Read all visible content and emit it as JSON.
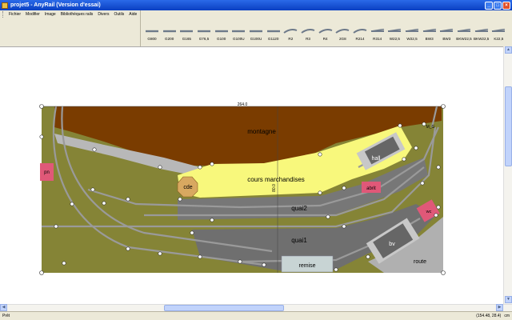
{
  "window": {
    "title": "projet5 - AnyRail (Version d'essai)"
  },
  "menu": [
    "Fichier",
    "Modifier",
    "Image",
    "Bibliothèques rails",
    "Divers",
    "Outils",
    "Aide"
  ],
  "tools": [
    "G800",
    "G200",
    "G165",
    "G76,5",
    "G100",
    "G100U",
    "G100U",
    "G1120",
    "R2",
    "R3",
    "R4",
    "2G8",
    "R214",
    "R314",
    "W22,5",
    "W22,5",
    "BW3",
    "BW3",
    "BKW22,5",
    "BKW22,5",
    "K22,5"
  ],
  "layout": {
    "length_dim": "264.0",
    "height_dim": "80.0",
    "labels": {
      "montagne": "montagne",
      "cours": "cours marchandises",
      "hall": "hall",
      "abrit": "abrit",
      "quai2": "quai2",
      "quai1": "quai1",
      "bv": "bv",
      "route": "route",
      "remise": "remise",
      "cde": "cde",
      "pn": "pn",
      "wc": "wc",
      "mg": "M_G"
    }
  },
  "status": {
    "left": "Prêt",
    "coords": "(154.48, 28.4)",
    "unit": "cm"
  },
  "colors": {
    "ground": "#858436",
    "mountain": "#7a3c00",
    "yard": "#f8f87c",
    "platform": "#777777",
    "building": "#e05878"
  }
}
